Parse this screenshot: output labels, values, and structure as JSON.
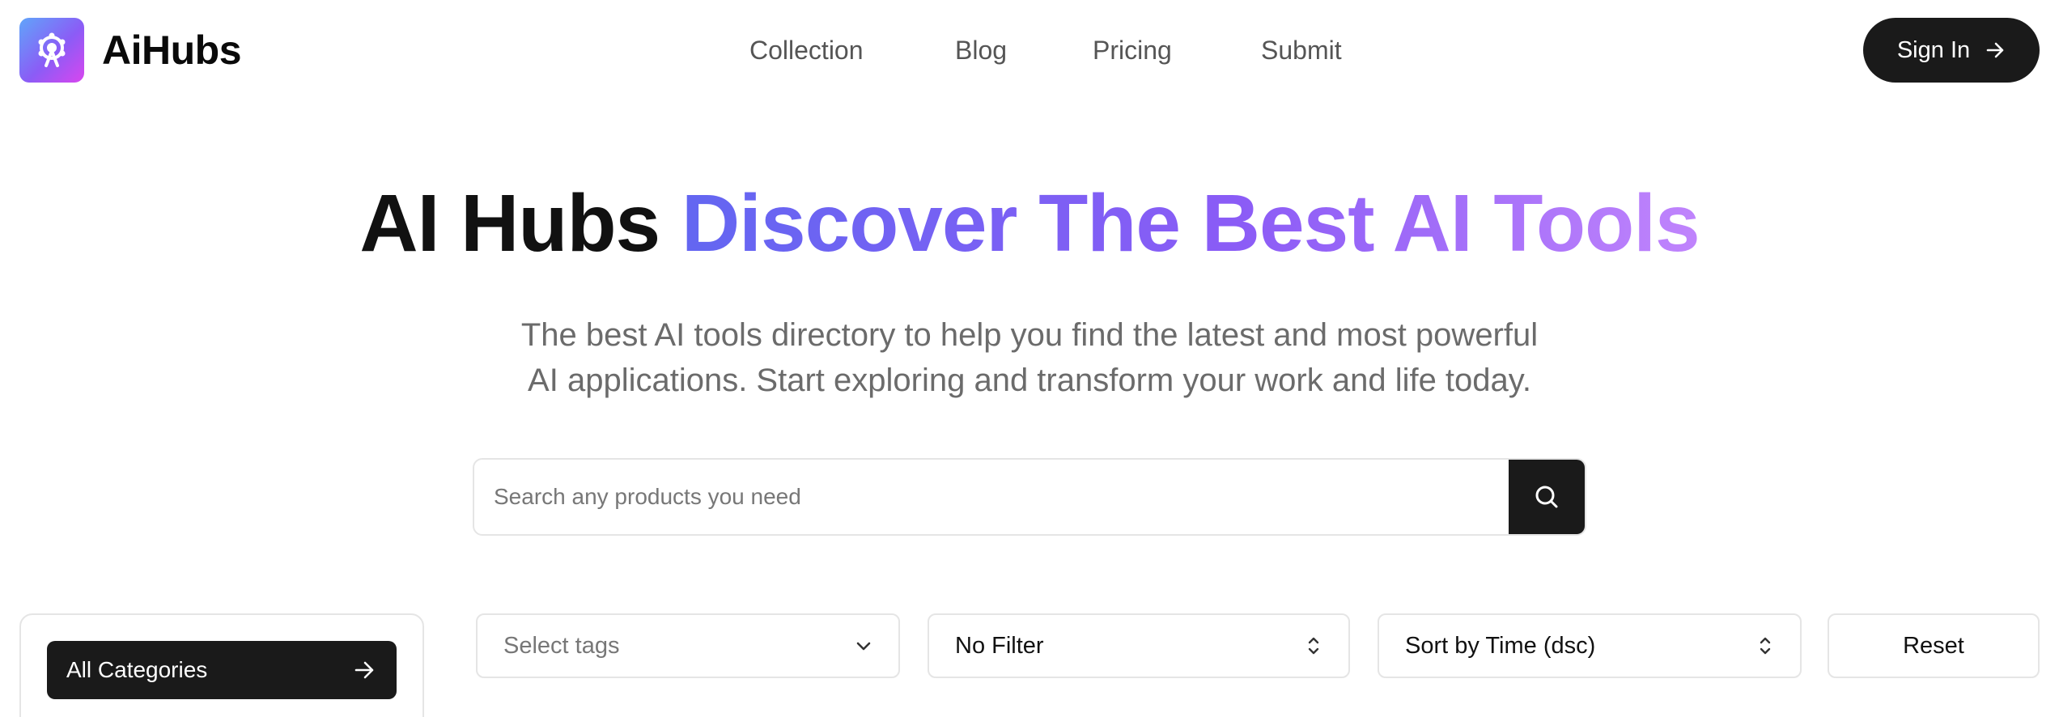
{
  "brand": {
    "name": "AiHubs",
    "logo_icon": "ferris-wheel-icon"
  },
  "nav": {
    "items": [
      "Collection",
      "Blog",
      "Pricing",
      "Submit"
    ]
  },
  "signin": {
    "label": "Sign In",
    "icon": "arrow-right-icon"
  },
  "hero": {
    "title_plain": "AI Hubs",
    "title_gradient": "Discover The Best AI Tools",
    "subtitle_line1": "The best AI tools directory to help you find the latest and most powerful",
    "subtitle_line2": "AI applications. Start exploring and transform your work and life today."
  },
  "search": {
    "placeholder": "Search any products you need",
    "value": "",
    "icon": "search-icon"
  },
  "filters": {
    "category_button": "All Categories",
    "tags_placeholder": "Select tags",
    "filter_value": "No Filter",
    "sort_value": "Sort by Time (dsc)",
    "reset_label": "Reset"
  },
  "colors": {
    "primary_dark": "#1a1a1a",
    "gradient_start": "#6366f1",
    "gradient_end": "#c084fc",
    "border": "#e5e5e5",
    "muted_text": "#6b6b6b"
  }
}
